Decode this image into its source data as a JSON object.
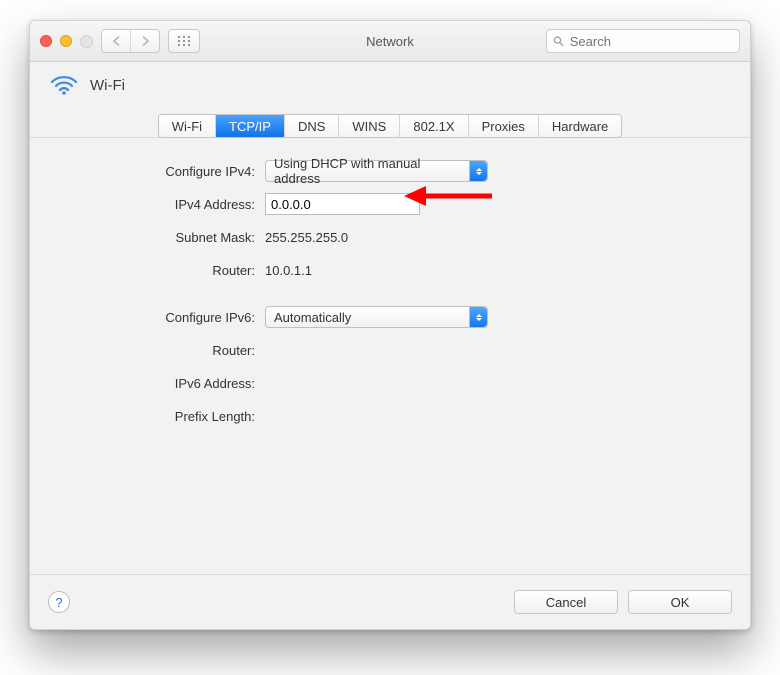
{
  "window": {
    "title": "Network"
  },
  "toolbar": {
    "search_placeholder": "Search"
  },
  "header": {
    "service_name": "Wi-Fi"
  },
  "tabs": [
    {
      "label": "Wi-Fi"
    },
    {
      "label": "TCP/IP",
      "active": true
    },
    {
      "label": "DNS"
    },
    {
      "label": "WINS"
    },
    {
      "label": "802.1X"
    },
    {
      "label": "Proxies"
    },
    {
      "label": "Hardware"
    }
  ],
  "form": {
    "configure_ipv4": {
      "label": "Configure IPv4:",
      "value": "Using DHCP with manual address"
    },
    "ipv4_address": {
      "label": "IPv4 Address:",
      "value": "0.0.0.0"
    },
    "subnet_mask": {
      "label": "Subnet Mask:",
      "value": "255.255.255.0"
    },
    "router_v4": {
      "label": "Router:",
      "value": "10.0.1.1"
    },
    "configure_ipv6": {
      "label": "Configure IPv6:",
      "value": "Automatically"
    },
    "router_v6": {
      "label": "Router:",
      "value": ""
    },
    "ipv6_address": {
      "label": "IPv6 Address:",
      "value": ""
    },
    "prefix_length": {
      "label": "Prefix Length:",
      "value": ""
    }
  },
  "footer": {
    "help": "?",
    "cancel": "Cancel",
    "ok": "OK"
  },
  "annotation": {
    "arrow_color": "#ff0000"
  }
}
